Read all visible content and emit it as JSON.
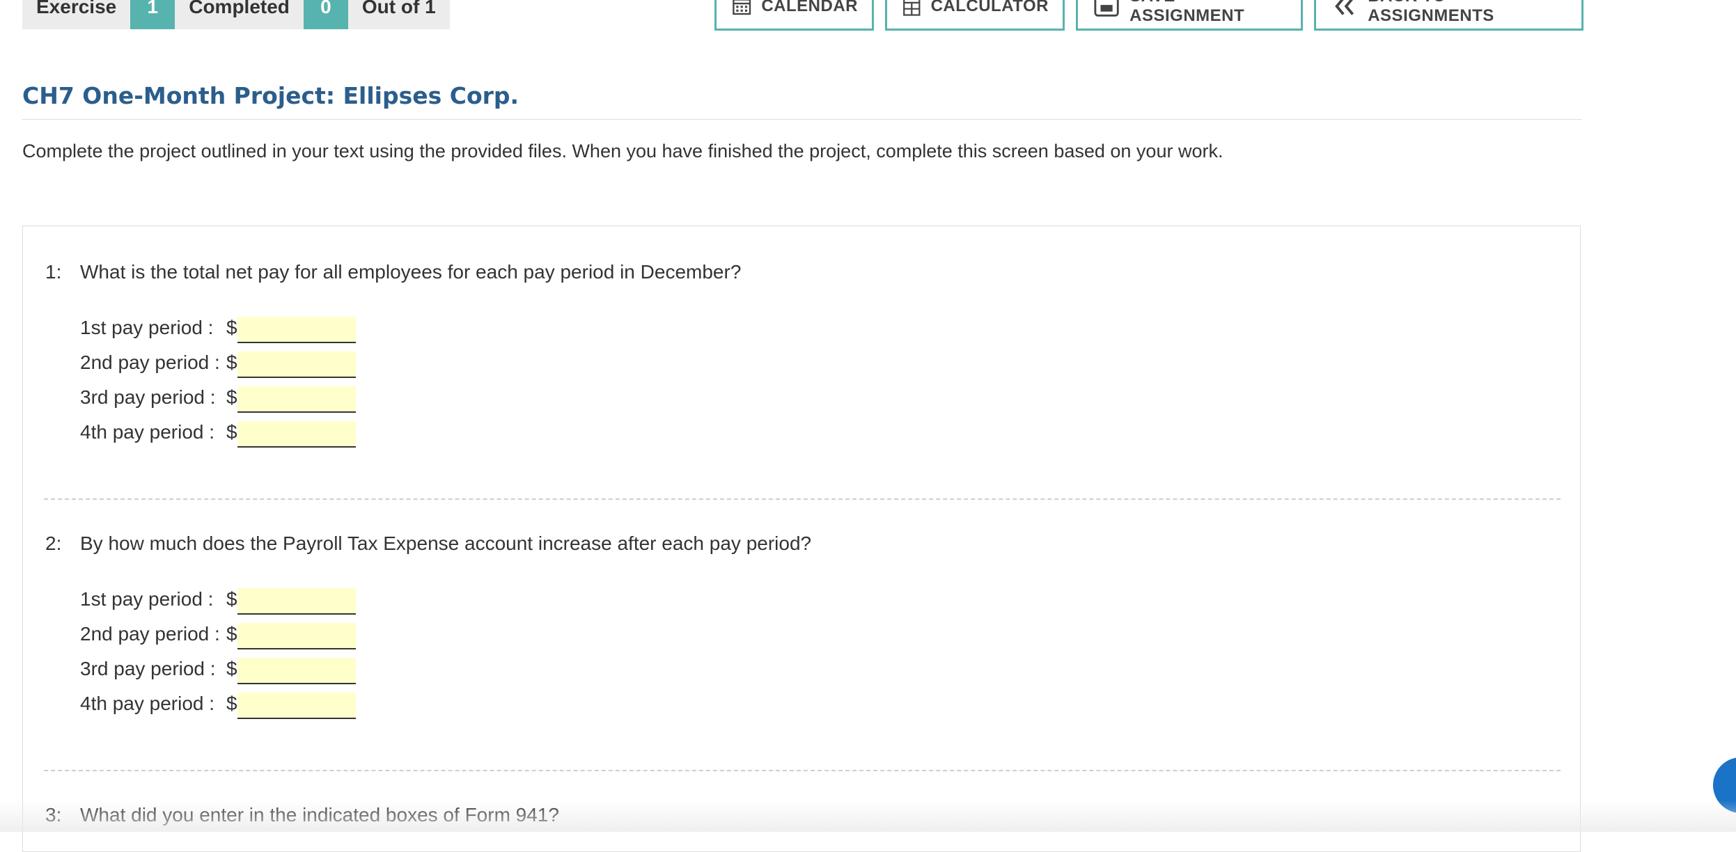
{
  "progress": {
    "exercise_label": "Exercise",
    "exercise_value": "1",
    "completed_label": "Completed",
    "completed_value": "0",
    "out_of_label": "Out of 1"
  },
  "toolbar": {
    "calendar": "CALENDAR",
    "calculator": "CALCULATOR",
    "save": "SAVE ASSIGNMENT",
    "back": "BACK TO ASSIGNMENTS"
  },
  "title": "CH7 One-Month Project: Ellipses Corp.",
  "intro": "Complete the project outlined in your text using the provided files. When you have finished the project, complete this screen based on your work.",
  "questions": [
    {
      "number": "1:",
      "text": "What is the total net pay for all employees for each pay period in December?",
      "rows": [
        {
          "label": "1st pay period :",
          "currency": "$",
          "value": ""
        },
        {
          "label": "2nd pay period :",
          "currency": "$",
          "value": ""
        },
        {
          "label": "3rd pay period :",
          "currency": "$",
          "value": ""
        },
        {
          "label": "4th pay period :",
          "currency": "$",
          "value": ""
        }
      ]
    },
    {
      "number": "2:",
      "text": "By how much does the Payroll Tax Expense account increase after each pay period?",
      "rows": [
        {
          "label": "1st pay period :",
          "currency": "$",
          "value": ""
        },
        {
          "label": "2nd pay period :",
          "currency": "$",
          "value": ""
        },
        {
          "label": "3rd pay period :",
          "currency": "$",
          "value": ""
        },
        {
          "label": "4th pay period :",
          "currency": "$",
          "value": ""
        }
      ]
    },
    {
      "number": "3:",
      "text": "What did you enter in the indicated boxes of Form 941?"
    }
  ],
  "colors": {
    "accent": "#57b3ad",
    "title": "#2b5e8c",
    "input_bg": "#ffffcc",
    "help_button": "#1a73c7"
  },
  "icons": [
    "calendar-icon",
    "calculator-icon",
    "save-icon",
    "double-chevron-left-icon"
  ]
}
